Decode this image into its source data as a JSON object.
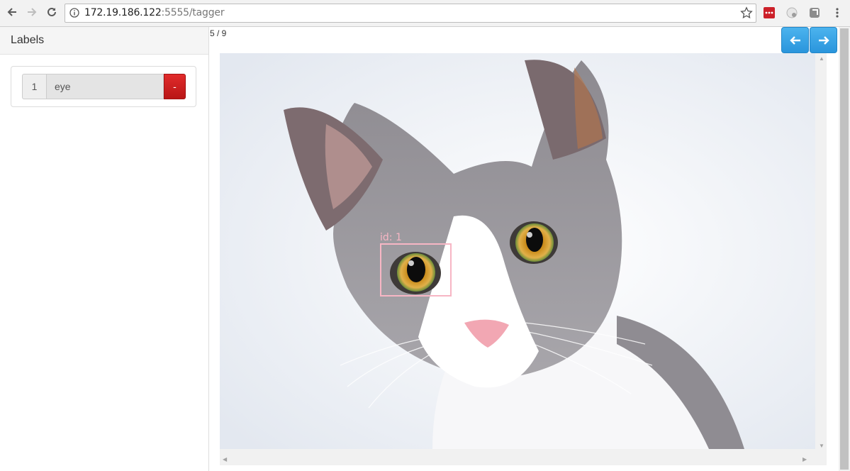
{
  "browser": {
    "url_host": "172.19.186.122",
    "url_rest": ":5555/tagger",
    "icons": [
      "back-icon",
      "forward-icon",
      "reload-icon",
      "info-icon",
      "star-icon",
      "lastpass-icon",
      "extension-icon",
      "extension-icon",
      "menu-icon"
    ]
  },
  "sidebar": {
    "title": "Labels",
    "labels": [
      {
        "id": "1",
        "name": "eye",
        "remove_label": "-"
      }
    ]
  },
  "main": {
    "counter": "5 / 9",
    "prev_icon": "arrow-left-icon",
    "next_icon": "arrow-right-icon",
    "image_subject": "cat photo",
    "annotation": {
      "tag": "id: 1",
      "color": "#f7b6c4"
    }
  },
  "colors": {
    "accent_blue": "#2a95dc",
    "remove_red": "#c91e1e"
  }
}
